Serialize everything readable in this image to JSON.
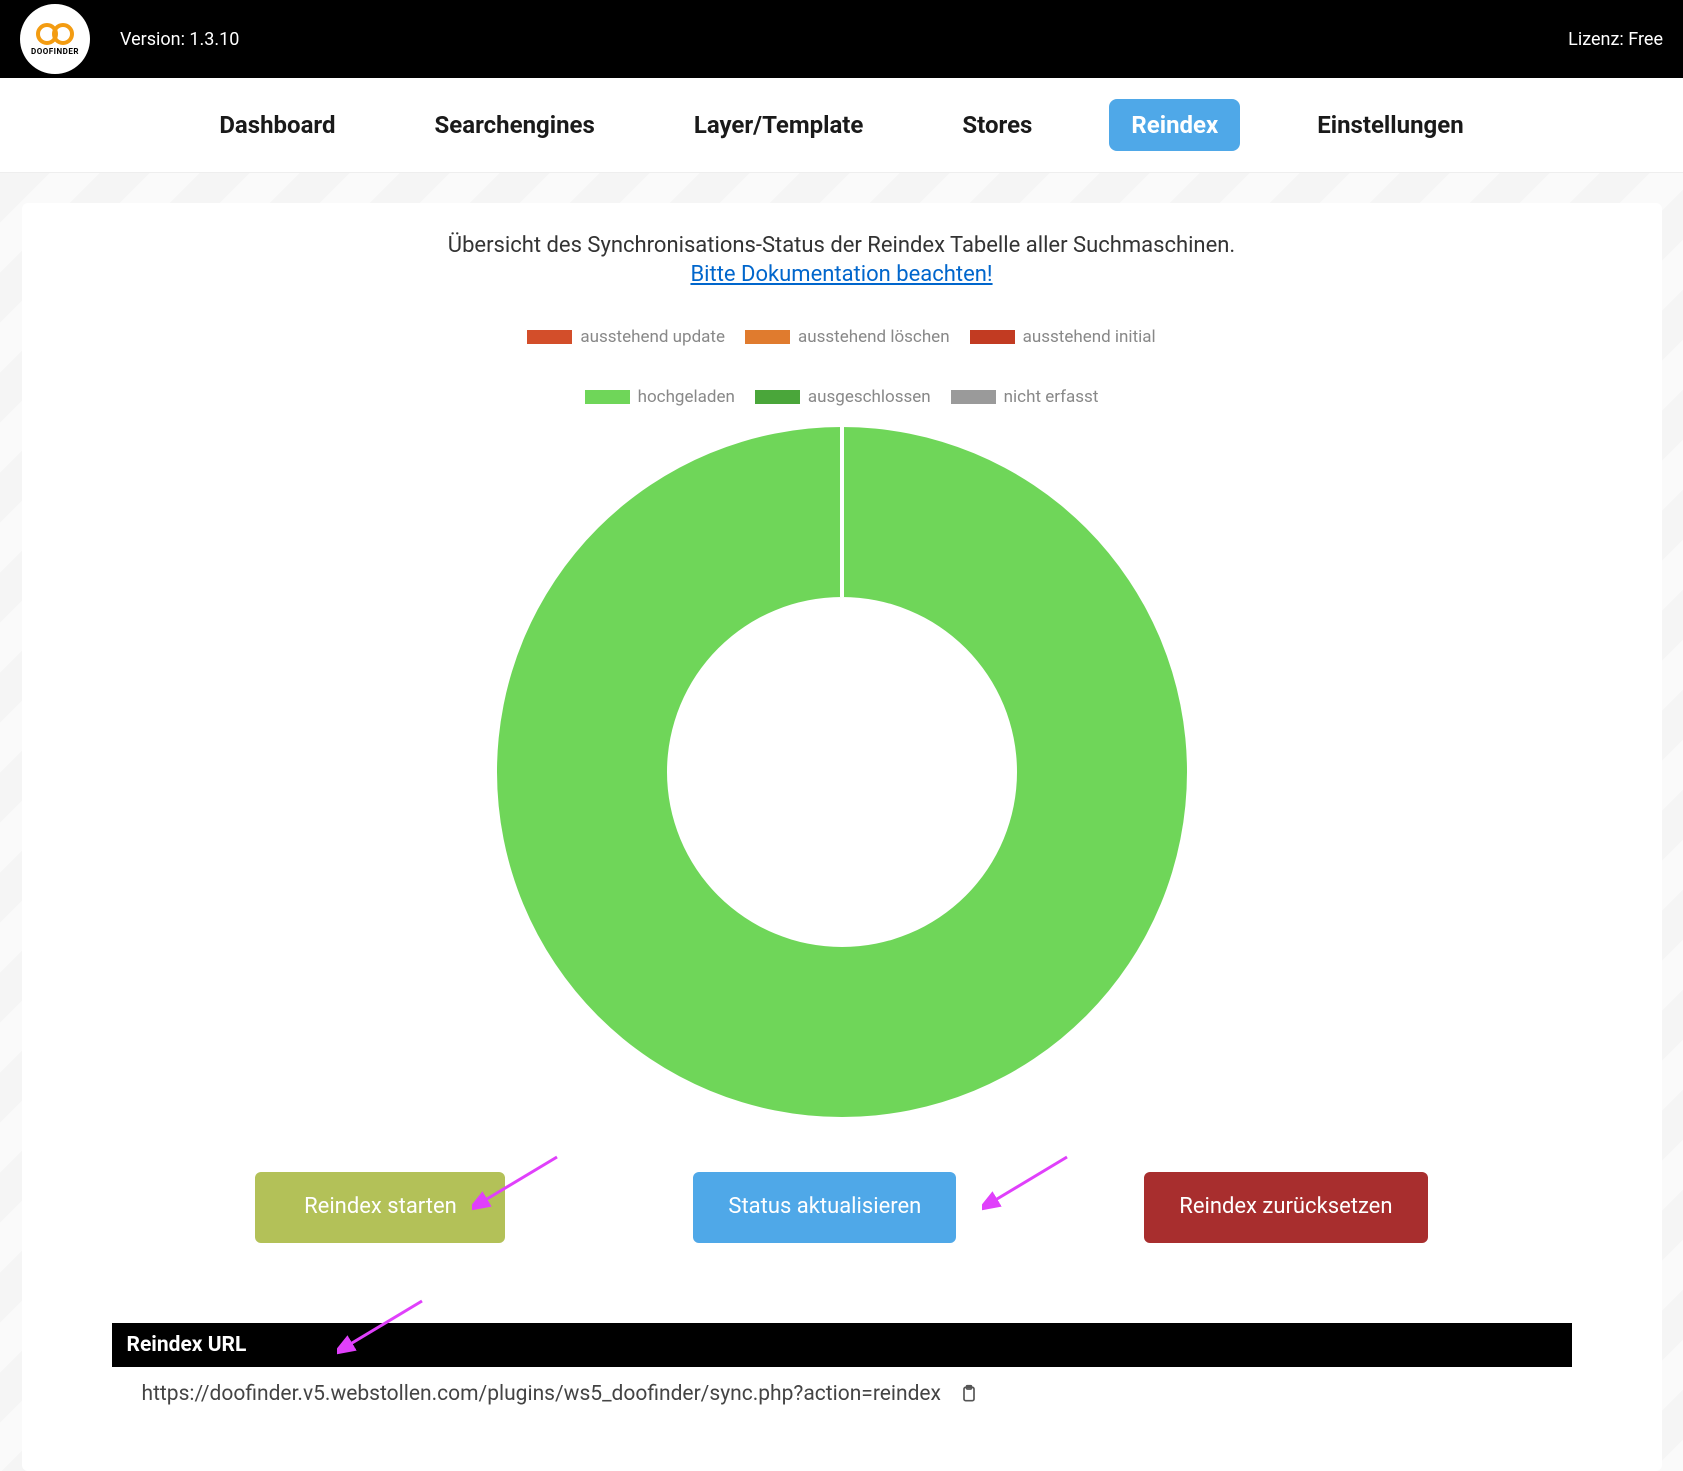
{
  "topbar": {
    "version": "Version: 1.3.10",
    "license": "Lizenz: Free",
    "logo_text": "DOOFINDER"
  },
  "nav": {
    "items": [
      {
        "label": "Dashboard",
        "active": false
      },
      {
        "label": "Searchengines",
        "active": false
      },
      {
        "label": "Layer/Template",
        "active": false
      },
      {
        "label": "Stores",
        "active": false
      },
      {
        "label": "Reindex",
        "active": true
      },
      {
        "label": "Einstellungen",
        "active": false
      }
    ]
  },
  "main": {
    "overview": "Übersicht des Synchronisations-Status der Reindex Tabelle aller Suchmaschinen.",
    "doc_link_label": "Bitte Dokumentation beachten!",
    "buttons": {
      "start": "Reindex starten",
      "refresh": "Status aktualisieren",
      "reset": "Reindex zurücksetzen"
    },
    "url_section": {
      "header": "Reindex URL",
      "url": "https://doofinder.v5.webstollen.com/plugins/ws5_doofinder/sync.php?action=reindex"
    }
  },
  "chart_data": {
    "type": "pie",
    "title": "",
    "series": [
      {
        "name": "ausstehend update",
        "value": 0,
        "color": "#d34e2a"
      },
      {
        "name": "ausstehend löschen",
        "value": 0,
        "color": "#e07b2e"
      },
      {
        "name": "ausstehend initial",
        "value": 0,
        "color": "#c23b22"
      },
      {
        "name": "hochgeladen",
        "value": 100,
        "color": "#6fd659"
      },
      {
        "name": "ausgeschlossen",
        "value": 0,
        "color": "#4aa63a"
      },
      {
        "name": "nicht erfasst",
        "value": 0,
        "color": "#9a9a9a"
      }
    ],
    "legend": {
      "row1": [
        {
          "label": "ausstehend update",
          "color": "#d34e2a"
        },
        {
          "label": "ausstehend löschen",
          "color": "#e07b2e"
        },
        {
          "label": "ausstehend initial",
          "color": "#c23b22"
        }
      ],
      "row2": [
        {
          "label": "hochgeladen",
          "color": "#6fd659"
        },
        {
          "label": "ausgeschlossen",
          "color": "#4aa63a"
        },
        {
          "label": "nicht erfasst",
          "color": "#9a9a9a"
        }
      ]
    }
  },
  "annotation_arrow_color": "#e040fb"
}
